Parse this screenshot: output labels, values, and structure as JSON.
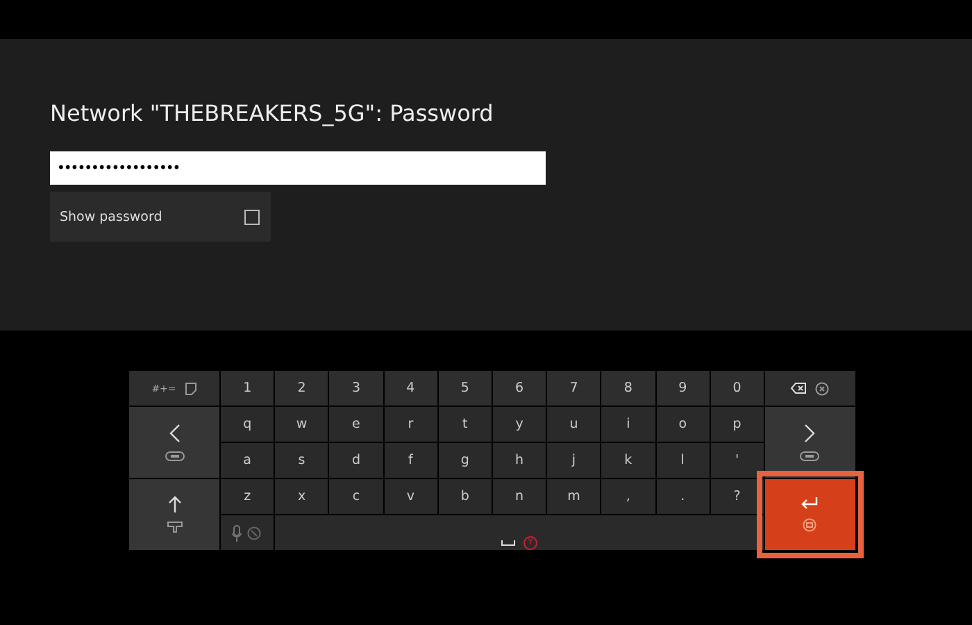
{
  "dialog": {
    "title": "Network \"THEBREAKERS_5G\": Password",
    "password": {
      "value": "••••••••••••••••••"
    },
    "show_password": {
      "label": "Show password",
      "checked": false
    }
  },
  "keyboard": {
    "symbols_key": {
      "label": "#+="
    },
    "rows": [
      [
        "1",
        "2",
        "3",
        "4",
        "5",
        "6",
        "7",
        "8",
        "9",
        "0"
      ],
      [
        "q",
        "w",
        "e",
        "r",
        "t",
        "y",
        "u",
        "i",
        "o",
        "p"
      ],
      [
        "a",
        "s",
        "d",
        "f",
        "g",
        "h",
        "j",
        "k",
        "l",
        "'"
      ],
      [
        "z",
        "x",
        "c",
        "v",
        "b",
        "n",
        "m",
        ",",
        ".",
        "?"
      ]
    ],
    "space_key": {
      "button_hint": "Y"
    },
    "enter_key": {
      "selected": true
    }
  }
}
